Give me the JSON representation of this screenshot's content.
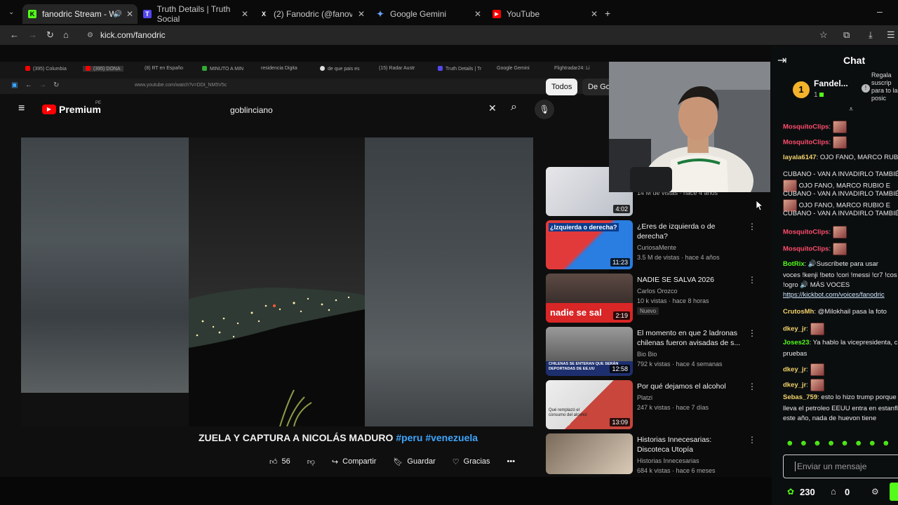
{
  "browser": {
    "tabs": [
      {
        "label": "fanodric Stream - Watch Li",
        "icon": "kick-logo-icon",
        "color": "#53fc18",
        "active": true
      },
      {
        "label": "Truth Details | Truth Social",
        "icon": "truth-social-icon",
        "color": "#5448ee"
      },
      {
        "label": "(2) Fanodric (@fanovargas) / X",
        "icon": "x-logo-icon",
        "color": "#ffffff"
      },
      {
        "label": "Google Gemini",
        "icon": "gemini-icon",
        "color": "#6aa4ff"
      },
      {
        "label": "YouTube",
        "icon": "youtube-icon",
        "color": "#ff0000"
      }
    ],
    "url": "kick.com/fanodric"
  },
  "capture": {
    "inner_tabs": [
      "(395) Columbia",
      "(395) DONA",
      "(8) RT en Españo",
      "MINUTO A MIN",
      "residencia Digita",
      "de que pais es",
      "(15) Radar Austr",
      "Truth Details | Tr",
      "Google Gemini",
      "Flightradar24: Li"
    ],
    "inner_url": "www.youtube.com/watch?v=DDt_NM5V5c",
    "youtube": {
      "logo": "Premium",
      "logo_sup": "PE",
      "search_value": "goblinciano"
    },
    "video": {
      "title": "ZUELA Y CAPTURA A NICOLÁS MADURO",
      "tags": "#peru #venezuela",
      "likes": "56",
      "share_label": "Compartir",
      "save_label": "Guardar",
      "thanks_label": "Gracias"
    },
    "chips": [
      "Todos",
      "De Go"
    ],
    "recommendations": [
      {
        "title": "",
        "channel": "",
        "meta": "14 M de vistas · hace 4 años",
        "duration": "4:02",
        "badge": ""
      },
      {
        "title": "¿Eres de izquierda o de derecha?",
        "channel": "CuriosaMente",
        "meta": "3.5 M de vistas · hace 4 años",
        "duration": "11:23",
        "badge": "",
        "thumb_text": "¿Izquierda o derecha?"
      },
      {
        "title": "NADIE SE SALVA 2026",
        "channel": "Carlos Orozco",
        "meta": "10 k vistas · hace 8 horas",
        "duration": "2:19",
        "badge": "Nuevo",
        "thumb_text": "nadie se sal"
      },
      {
        "title": "El momento en que 2 ladronas chilenas fueron avisadas de s...",
        "channel": "Bio Bio",
        "meta": "792 k vistas · hace 4 semanas",
        "duration": "12:58",
        "badge": "",
        "thumb_text": "CHILENAS SE ENTERAN QUE SERÁN DEPORTADAS DE EE.UU"
      },
      {
        "title": "Por qué dejamos el alcohol",
        "channel": "Platzi",
        "meta": "247 k vistas · hace 7 días",
        "duration": "13:09",
        "badge": "",
        "thumb_text": "Qué remplazó el consumo del alcohol"
      },
      {
        "title": "Historias Innecesarias: Discoteca Utopía",
        "channel": "Historias Innecesarias",
        "meta": "684 k vistas · hace 6 meses",
        "duration": "",
        "badge": ""
      }
    ]
  },
  "chat": {
    "title": "Chat",
    "top_gifter": {
      "name": "Fandel...",
      "rank": "1",
      "count": "1"
    },
    "promo": "Regala suscrip para to la posic",
    "messages": [
      {
        "user": "MosquitoClips",
        "color": "#ff4d6d",
        "text": "",
        "emote": true
      },
      {
        "user": "MosquitoClips",
        "color": "#ff4d6d",
        "text": "",
        "emote": true
      },
      {
        "user": "layala6147",
        "color": "#f3d36b",
        "text": "OJO FANO, MARCO RUBIO",
        "emote": false
      },
      {
        "user": "",
        "color": "#e8e8e8",
        "text": "CUBANO - VAN A INVADIRLO TAMBIÉN",
        "emote": false
      },
      {
        "user": "",
        "color": "#e8e8e8",
        "text": "OJO FANO, MARCO RUBIO E",
        "emote": true
      },
      {
        "user": "",
        "color": "#e8e8e8",
        "text": "CUBANO - VAN A INVADIRLO TAMBIÉN",
        "emote": false
      },
      {
        "user": "",
        "color": "#e8e8e8",
        "text": "OJO FANO, MARCO RUBIO E",
        "emote": true
      },
      {
        "user": "",
        "color": "#e8e8e8",
        "text": "CUBANO - VAN A INVADIRLO TAMBIÉN",
        "emote": false
      },
      {
        "user": "MosquitoClips",
        "color": "#ff4d6d",
        "text": "",
        "emote": true
      },
      {
        "user": "MosquitoClips",
        "color": "#ff4d6d",
        "text": "",
        "emote": true
      },
      {
        "user": "BotRix",
        "color": "#53fc18",
        "text": "🔊Suscríbete para usar",
        "emote": false
      },
      {
        "user": "",
        "color": "#e8e8e8",
        "text": "voces !kenji !beto !cori !messi !cr7 !cos",
        "emote": false
      },
      {
        "user": "",
        "color": "#e8e8e8",
        "text": "!ogro 🔊 MÁS VOCES",
        "emote": false
      },
      {
        "user": "",
        "color": "#e8e8e8",
        "text": "https://kickbot.com/voices/fanodric",
        "emote": false
      },
      {
        "user": "CrutosMh",
        "color": "#f3d36b",
        "text": "@Milokhail pasa la foto",
        "emote": false
      },
      {
        "user": "dkey_jr",
        "color": "#f3d36b",
        "text": "",
        "emote": true
      },
      {
        "user": "Joses23",
        "color": "#53fc18",
        "text": "Ya hablo la vicepresidenta, c",
        "emote": false
      },
      {
        "user": "",
        "color": "#e8e8e8",
        "text": "pruebas",
        "emote": false
      },
      {
        "user": "dkey_jr",
        "color": "#f3d36b",
        "text": "",
        "emote": true
      },
      {
        "user": "dkey_jr",
        "color": "#f3d36b",
        "text": "",
        "emote": true
      },
      {
        "user": "Sebas_759",
        "color": "#f3d36b",
        "text": "esto lo hizo trump porque",
        "emote": false
      },
      {
        "user": "",
        "color": "#e8e8e8",
        "text": "lleva el petroleo EEUU entra en estanfl",
        "emote": false
      },
      {
        "user": "",
        "color": "#e8e8e8",
        "text": "este año, nada de huevon tiene",
        "emote": false
      }
    ],
    "input_placeholder": "Enviar un mensaje",
    "points": "230",
    "store_count": "0"
  }
}
